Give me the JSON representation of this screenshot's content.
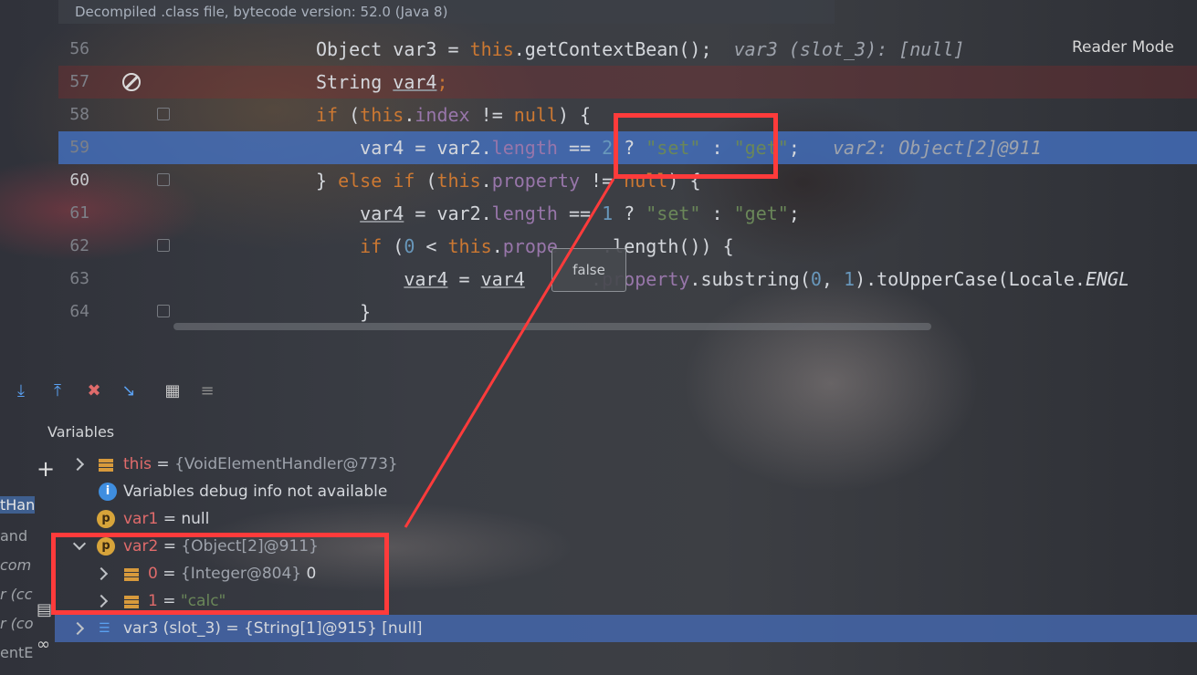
{
  "banner": "Decompiled .class file, bytecode version: 52.0 (Java 8)",
  "reader_mode": "Reader Mode",
  "editor": {
    "lines": [
      {
        "num": "56",
        "tokens": [
          [
            "t",
            "Object var3 = "
          ],
          [
            "kw",
            "this"
          ],
          [
            "t",
            ".getContextBean();  "
          ],
          [
            "hint",
            "var3 (slot_3): [null]"
          ]
        ]
      },
      {
        "num": "57",
        "tokens": [
          [
            "t",
            "String "
          ],
          [
            "ul",
            "var4"
          ],
          [
            "kw",
            ";"
          ]
        ]
      },
      {
        "num": "58",
        "tokens": [
          [
            "kw",
            "if "
          ],
          [
            "t",
            "("
          ],
          [
            "kw",
            "this"
          ],
          [
            "t",
            "."
          ],
          [
            "fld",
            "index"
          ],
          [
            "t",
            " != "
          ],
          [
            "kw",
            "null"
          ],
          [
            "t",
            ") {"
          ]
        ]
      },
      {
        "num": "59",
        "tokens": [
          [
            "t",
            "    var4 = var2."
          ],
          [
            "fld",
            "length"
          ],
          [
            "t",
            " == "
          ],
          [
            "num",
            "2"
          ],
          [
            "t",
            " ? "
          ],
          [
            "str",
            "\"set\""
          ],
          [
            "t",
            " : "
          ],
          [
            "str",
            "\"get\""
          ],
          [
            "t",
            ";   "
          ],
          [
            "hint",
            "var2: Object[2]@911"
          ]
        ]
      },
      {
        "num": "60",
        "tokens": [
          [
            "t",
            "} "
          ],
          [
            "kw",
            "else if "
          ],
          [
            "t",
            "("
          ],
          [
            "kw",
            "this"
          ],
          [
            "t",
            "."
          ],
          [
            "fld",
            "property"
          ],
          [
            "t",
            " != "
          ],
          [
            "kw",
            "null"
          ],
          [
            "t",
            ") {"
          ]
        ]
      },
      {
        "num": "61",
        "tokens": [
          [
            "t",
            "    "
          ],
          [
            "ul",
            "var4"
          ],
          [
            "t",
            " = var2."
          ],
          [
            "fld",
            "length"
          ],
          [
            "t",
            " == "
          ],
          [
            "num",
            "1"
          ],
          [
            "t",
            " ? "
          ],
          [
            "str",
            "\"set\""
          ],
          [
            "t",
            " : "
          ],
          [
            "str",
            "\"get\""
          ],
          [
            "t",
            ";"
          ]
        ]
      },
      {
        "num": "62",
        "tokens": [
          [
            "t",
            "    "
          ],
          [
            "kw",
            "if "
          ],
          [
            "t",
            "("
          ],
          [
            "num",
            "0"
          ],
          [
            "t",
            " < "
          ],
          [
            "kw",
            "this"
          ],
          [
            "t",
            "."
          ],
          [
            "fld",
            "prope"
          ],
          [
            "t",
            "    .length()) {"
          ]
        ]
      },
      {
        "num": "63",
        "tokens": [
          [
            "t",
            "        "
          ],
          [
            "ul",
            "var4"
          ],
          [
            "t",
            " = "
          ],
          [
            "ul",
            "var4"
          ],
          [
            "t",
            "      ."
          ],
          [
            "fld",
            "property"
          ],
          [
            "t",
            ".substring("
          ],
          [
            "num",
            "0"
          ],
          [
            "t",
            ", "
          ],
          [
            "num",
            "1"
          ],
          [
            "t",
            ").toUpperCase(Locale."
          ],
          [
            "ital",
            "ENGL"
          ]
        ]
      },
      {
        "num": "64",
        "tokens": [
          [
            "t",
            "    }"
          ]
        ]
      }
    ],
    "tooltip": "false"
  },
  "debugger": {
    "variables_title": "Variables",
    "left_fragments": [
      "tHan",
      "and",
      "com",
      "r (cc",
      "r (co",
      "entE"
    ],
    "rows": [
      {
        "icon": "field",
        "expander": "right",
        "name": "this",
        "eq": " = ",
        "value": "{VoidElementHandler@773}",
        "extra": ""
      },
      {
        "icon": "info",
        "expander": "",
        "name": "Variables debug info not available",
        "eq": "",
        "value": "",
        "extra": ""
      },
      {
        "icon": "p",
        "expander": "",
        "name": "var1",
        "eq": " = ",
        "value": "",
        "extra": "null"
      },
      {
        "icon": "p",
        "expander": "down",
        "name": "var2",
        "eq": " = ",
        "value": "{Object[2]@911}",
        "extra": ""
      },
      {
        "icon": "field",
        "expander": "right",
        "name": "0",
        "eq": " = ",
        "value": "{Integer@804}",
        "extra": " 0"
      },
      {
        "icon": "field",
        "expander": "right",
        "name": "1",
        "eq": " = ",
        "value": "",
        "extra": "\"calc\""
      },
      {
        "icon": "array",
        "expander": "right",
        "name": "var3 (slot_3)",
        "eq": " = ",
        "value": "{String[1]@915}",
        "extra": " [null]"
      }
    ]
  },
  "colors": {
    "annotation": "#ff3b3b",
    "exec_line": "#4472c4"
  }
}
